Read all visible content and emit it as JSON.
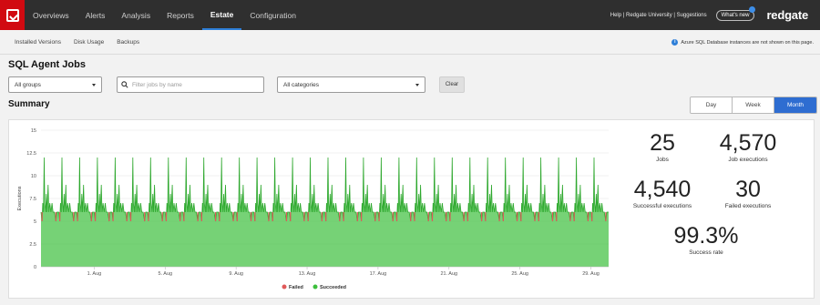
{
  "colors": {
    "brand_red": "#d10a11",
    "accent_blue": "#2e6dd1",
    "failed": "#e05a5a",
    "succeeded": "#3cbf3c",
    "succeeded_fill": "#78cc78"
  },
  "header": {
    "logo_icon": "redgate-monitor-icon",
    "nav": [
      "Overviews",
      "Alerts",
      "Analysis",
      "Reports",
      "Estate",
      "Configuration"
    ],
    "active_nav": "Estate",
    "help_links": "Help | Redgate University | Suggestions",
    "whats_new": "What's new",
    "brand": "redgate"
  },
  "subnav": {
    "items": [
      "Installed Versions",
      "Disk Usage",
      "Backups"
    ],
    "notice": "Azure SQL Database instances are not shown on this page."
  },
  "page": {
    "title": "SQL Agent Jobs"
  },
  "filters": {
    "group": "All groups",
    "search_placeholder": "Filter jobs by name",
    "category": "All categories",
    "clear_label": "Clear"
  },
  "summary": {
    "title": "Summary",
    "ranges": [
      "Day",
      "Week",
      "Month"
    ],
    "active_range": "Month",
    "stats": {
      "jobs": {
        "value": "25",
        "label": "Jobs"
      },
      "executions": {
        "value": "4,570",
        "label": "Job executions"
      },
      "successful": {
        "value": "4,540",
        "label": "Successful executions"
      },
      "failed": {
        "value": "30",
        "label": "Failed executions"
      },
      "rate": {
        "value": "99.3%",
        "label": "Success rate"
      }
    }
  },
  "chart_data": {
    "type": "area",
    "xlabel": "",
    "ylabel": "Executions",
    "ylim": [
      0,
      15
    ],
    "yticks": [
      "0",
      "2.5",
      "5",
      "7.5",
      "10",
      "12.5",
      "15"
    ],
    "xticks": [
      "1. Aug",
      "5. Aug",
      "9. Aug",
      "13. Aug",
      "17. Aug",
      "21. Aug",
      "25. Aug",
      "29. Aug"
    ],
    "grid": true,
    "legend_position": "bottom",
    "series": [
      {
        "name": "Failed",
        "color": "#e05a5a"
      },
      {
        "name": "Succeeded",
        "color": "#3cbf3c"
      }
    ],
    "baseline_value": 6,
    "daily_peak": 12,
    "x_start_day": -2,
    "x_end_day": 30,
    "day_pattern": [
      {
        "t": 0.0,
        "v": 6
      },
      {
        "t": 0.06,
        "v": 5
      },
      {
        "t": 0.1,
        "v": 7
      },
      {
        "t": 0.14,
        "v": 6
      },
      {
        "t": 0.18,
        "v": 12
      },
      {
        "t": 0.21,
        "v": 7
      },
      {
        "t": 0.26,
        "v": 6
      },
      {
        "t": 0.3,
        "v": 8
      },
      {
        "t": 0.34,
        "v": 6
      },
      {
        "t": 0.4,
        "v": 9
      },
      {
        "t": 0.44,
        "v": 6
      },
      {
        "t": 0.5,
        "v": 7
      },
      {
        "t": 0.56,
        "v": 6
      },
      {
        "t": 0.62,
        "v": 7
      },
      {
        "t": 0.68,
        "v": 6
      },
      {
        "t": 0.76,
        "v": 6
      },
      {
        "t": 0.84,
        "v": 5
      },
      {
        "t": 0.9,
        "v": 6
      },
      {
        "t": 1.0,
        "v": 6
      }
    ],
    "failed_day_offsets": [
      0.06,
      0.84
    ]
  }
}
